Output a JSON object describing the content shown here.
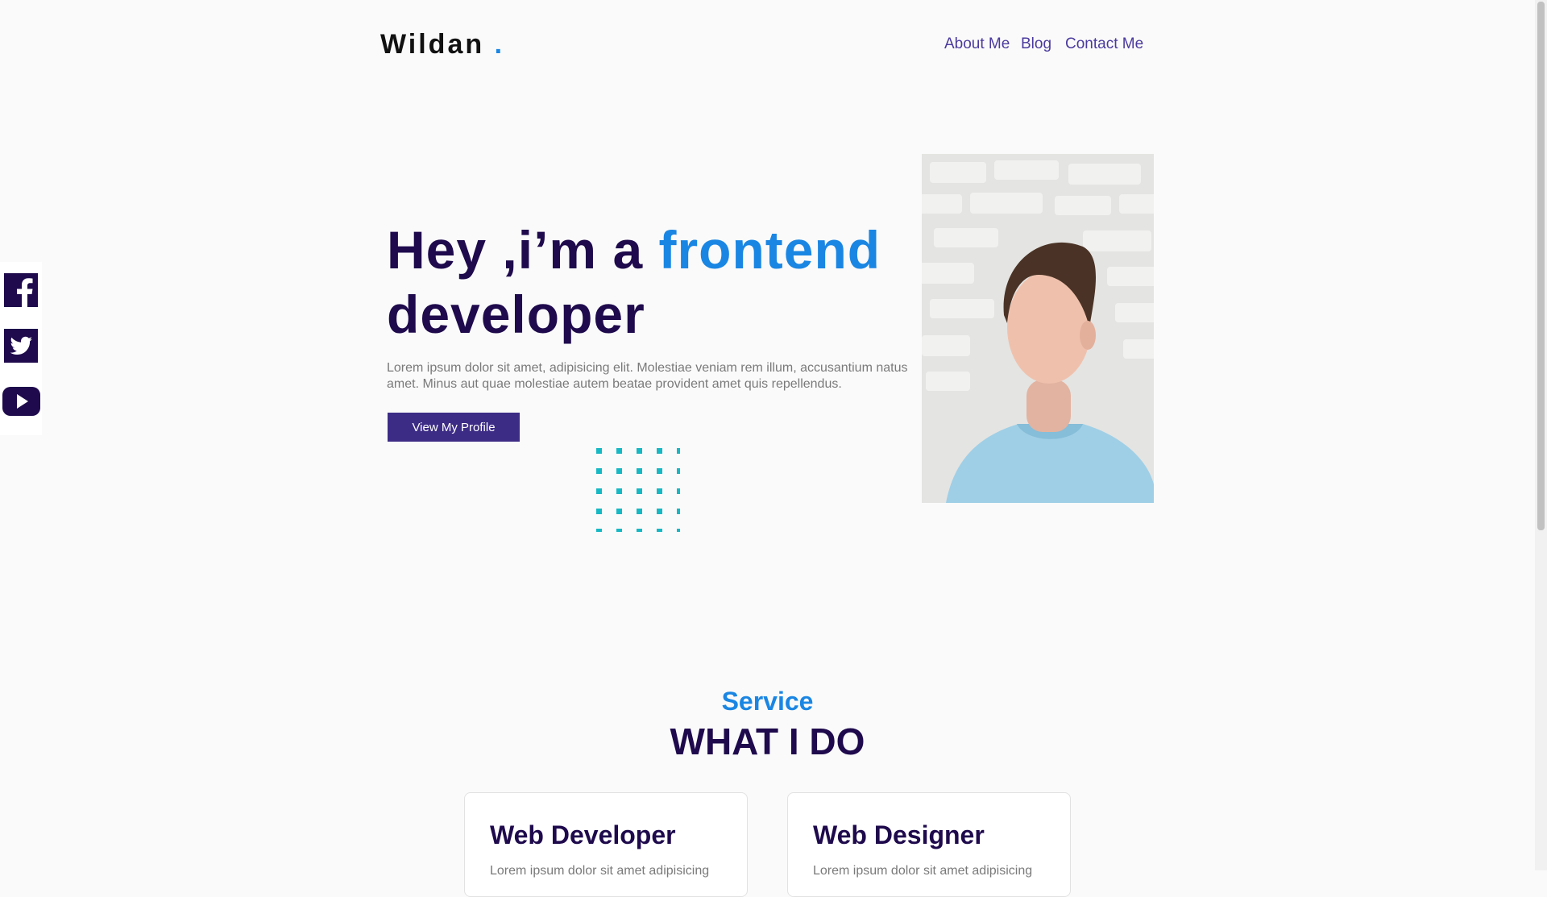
{
  "navbar": {
    "logo": "Wildan",
    "logo_dot": ".",
    "links": [
      "About Me",
      "Blog",
      "Contact Me"
    ]
  },
  "social": [
    "facebook-icon",
    "twitter-icon",
    "youtube-icon"
  ],
  "hero": {
    "title_prefix": "Hey ,i’m a",
    "title_accent": "frontend",
    "title_suffix": "developer",
    "description": "Lorem ipsum dolor sit amet, adipisicing elit. Molestiae veniam rem illum, accusantium natus amet. Minus aut quae molestiae autem beatae provident amet quis repellendus.",
    "button": "View My Profile"
  },
  "service": {
    "label": "Service",
    "heading": "WHAT I DO",
    "cards": [
      {
        "title": "Web Developer",
        "text": "Lorem ipsum dolor sit amet adipisicing"
      },
      {
        "title": "Web Designer",
        "text": "Lorem ipsum dolor sit amet adipisicing"
      }
    ]
  },
  "colors": {
    "accent": "#1a86e3",
    "primary_dark": "#1e0a4c",
    "button": "#3d2c86",
    "dots": "#16b8c4"
  }
}
